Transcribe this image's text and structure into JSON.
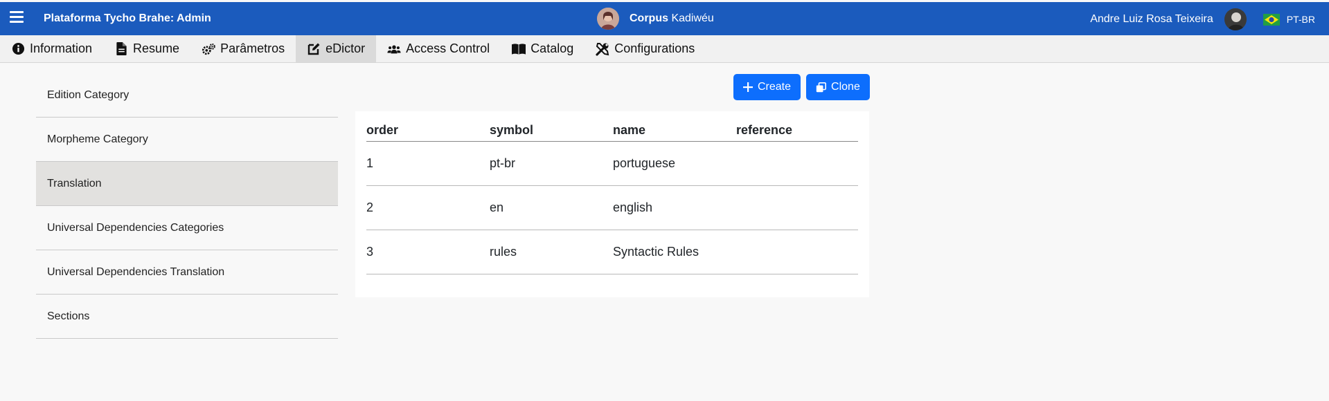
{
  "topbar": {
    "app_title": "Plataforma Tycho Brahe: Admin",
    "corpus_label": "Corpus",
    "corpus_name": "Kadiwéu",
    "user_name": "Andre Luiz Rosa Teixeira",
    "language": "PT-BR",
    "brand_color": "#1b5bbd"
  },
  "tabs": [
    {
      "label": "Information",
      "icon": "info-circle-icon"
    },
    {
      "label": "Resume",
      "icon": "document-icon"
    },
    {
      "label": "Parâmetros",
      "icon": "gears-icon"
    },
    {
      "label": "eDictor",
      "icon": "edit-icon",
      "active": true
    },
    {
      "label": "Access Control",
      "icon": "users-icon"
    },
    {
      "label": "Catalog",
      "icon": "book-icon"
    },
    {
      "label": "Configurations",
      "icon": "tools-icon"
    }
  ],
  "sidebar": {
    "items": [
      {
        "label": "Edition Category"
      },
      {
        "label": "Morpheme Category"
      },
      {
        "label": "Translation",
        "active": true
      },
      {
        "label": "Universal Dependencies Categories"
      },
      {
        "label": "Universal Dependencies Translation"
      },
      {
        "label": "Sections"
      }
    ]
  },
  "actions": {
    "create_label": "Create",
    "clone_label": "Clone",
    "button_color": "#0d6efd"
  },
  "table": {
    "columns": [
      "order",
      "symbol",
      "name",
      "reference"
    ],
    "rows": [
      {
        "order": "1",
        "symbol": "pt-br",
        "name": "portuguese",
        "reference": ""
      },
      {
        "order": "2",
        "symbol": "en",
        "name": "english",
        "reference": ""
      },
      {
        "order": "3",
        "symbol": "rules",
        "name": "Syntactic Rules",
        "reference": ""
      }
    ]
  }
}
